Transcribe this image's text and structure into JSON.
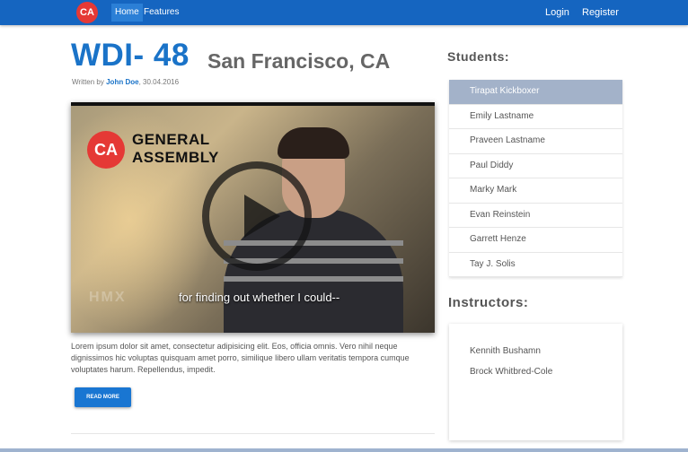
{
  "navbar": {
    "logo_text": "CA",
    "links": [
      "Home",
      "Features"
    ],
    "login": "Login",
    "register": "Register"
  },
  "post": {
    "title": "WDI- 48",
    "location": "San Francisco, CA",
    "byline_prefix": "Written by",
    "author": "John Doe",
    "date": ", 30.04.2016",
    "body": "Lorem ipsum dolor sit amet, consectetur adipisicing elit. Eos, officia omnis. Vero nihil neque dignissimos hic voluptas quisquam amet porro, similique libero ullam veritatis tempora cumque voluptates harum. Repellendus, impedit.",
    "read_more": "READ MORE"
  },
  "video": {
    "badge_text": "CA",
    "brand_line1": "GENERAL",
    "brand_line2": "ASSEMBLY",
    "watermark": "HMX",
    "caption": "for finding out whether I could--"
  },
  "sidebar": {
    "students_title": "Students:",
    "students": [
      "Tirapat Kickboxer",
      "Emily Lastname",
      "Praveen Lastname",
      "Paul Diddy",
      "Marky Mark",
      "Evan Reinstein",
      "Garrett Henze",
      "Tay J. Solis"
    ],
    "instructors_title": "Instructors:",
    "instructors": [
      "Kennith Bushamn",
      "Brock Whitbred-Cole"
    ]
  },
  "colors": {
    "navbar": "#1565c0",
    "title_blue": "#1a73c8",
    "active_student": "#a3b2c9",
    "button": "#1976d2",
    "logo_red": "#e53935"
  }
}
